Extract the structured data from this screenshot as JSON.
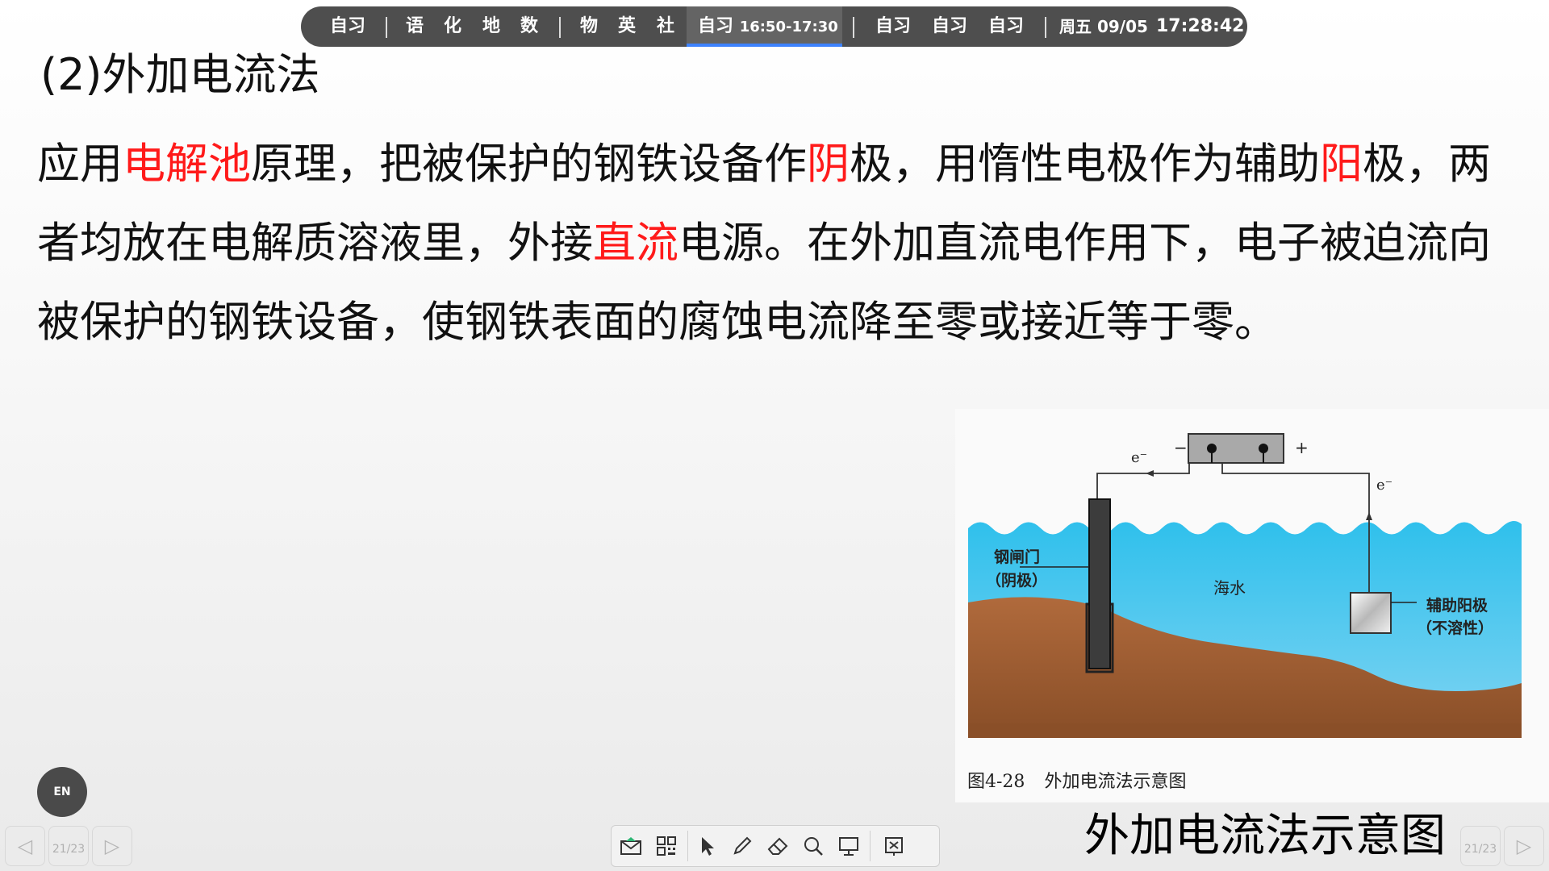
{
  "schedule": {
    "group1": [
      "自习"
    ],
    "group2": [
      "语",
      "化",
      "地",
      "数"
    ],
    "group3": [
      "物",
      "英",
      "社"
    ],
    "current": {
      "label": "自习",
      "time": "16:50-17:30"
    },
    "group4": [
      "自习",
      "自习",
      "自习"
    ],
    "date": "周五 09/05",
    "clock": "17:28:42"
  },
  "slide": {
    "heading": "(2)外加电流法",
    "paragraph": [
      {
        "text": "应用",
        "red": false
      },
      {
        "text": "电解池",
        "red": true
      },
      {
        "text": "原理，把被保护的钢铁设备作",
        "red": false
      },
      {
        "text": "阴",
        "red": true
      },
      {
        "text": "极，用惰性电极作为辅助",
        "red": false
      },
      {
        "text": "阳",
        "red": true
      },
      {
        "text": "极，两者均放在电解质溶液里，外接",
        "red": false
      },
      {
        "text": "直流",
        "red": true
      },
      {
        "text": "电源。在外加直流电作用下，电子被迫流向被保护的钢铁设备，使钢铁表面的腐蚀电流降至零或接近等于零。",
        "red": false
      }
    ],
    "figure": {
      "minus": "−",
      "plus": "+",
      "electron_left": "e⁻",
      "electron_right": "e⁻",
      "gate_label_1": "钢闸门",
      "gate_label_2": "（阴极）",
      "water_label": "海水",
      "anode_label_1": "辅助阳极",
      "anode_label_2": "（不溶性）",
      "caption_num": "图4-28",
      "caption_text": "外加电流法示意图"
    },
    "big_caption": "外加电流法示意图"
  },
  "controls": {
    "lang_button": "EN",
    "page_indicator": "21/23",
    "prev_icon": "◁",
    "next_icon": "▷",
    "accent": "#3d82ff",
    "red_text": "#ff1a1a",
    "toolbar_icons": [
      "email-icon",
      "qr-code-icon",
      "pointer-icon",
      "pen-icon",
      "eraser-icon",
      "magnifier-icon",
      "whiteboard-icon",
      "exit-icon"
    ]
  }
}
